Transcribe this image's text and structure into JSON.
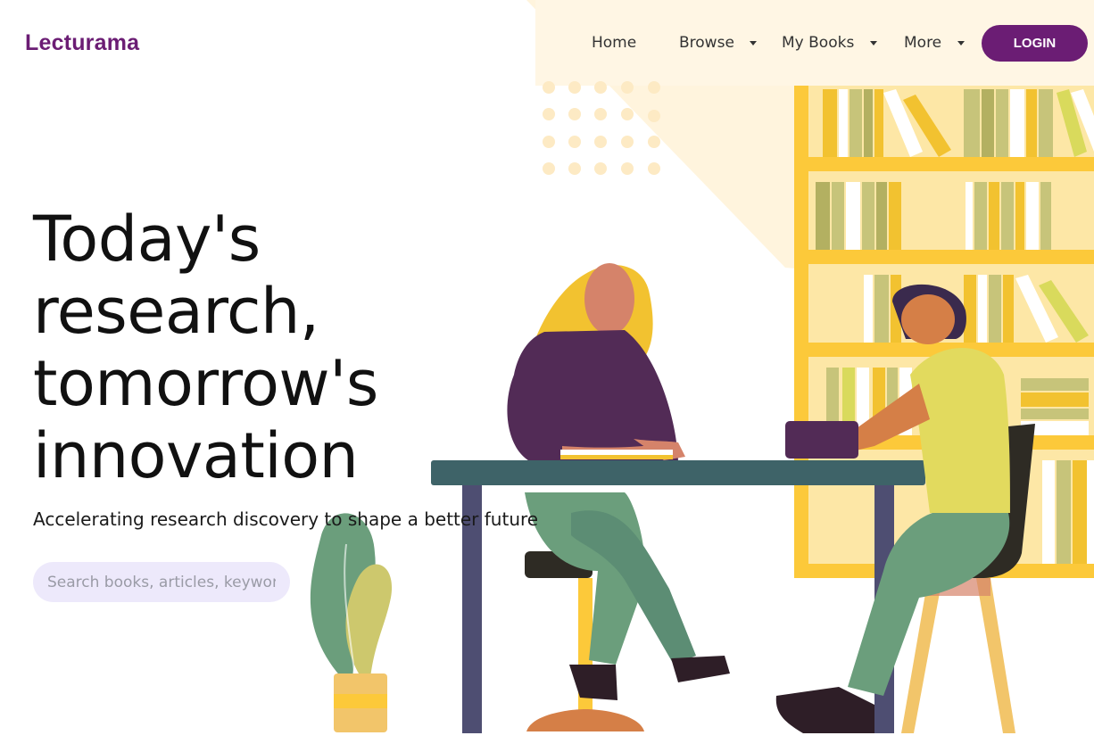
{
  "header": {
    "brand": "Lecturama",
    "nav": [
      {
        "label": "Home"
      },
      {
        "label": "Browse"
      },
      {
        "label": "My Books"
      },
      {
        "label": "More"
      }
    ],
    "login_label": "LOGIN"
  },
  "hero": {
    "title_lines": [
      "Today's",
      "research,",
      "tomorrow's",
      "innovation"
    ],
    "subtitle": "Accelerating research discovery to shape a better future",
    "search_placeholder": "Search books, articles, keywords"
  },
  "colors": {
    "brand": "#6b1d74",
    "search_bg": "#ede9fb",
    "shelf": "#fcc93a"
  },
  "icons": {
    "dropdown": "chevron-down-icon"
  }
}
